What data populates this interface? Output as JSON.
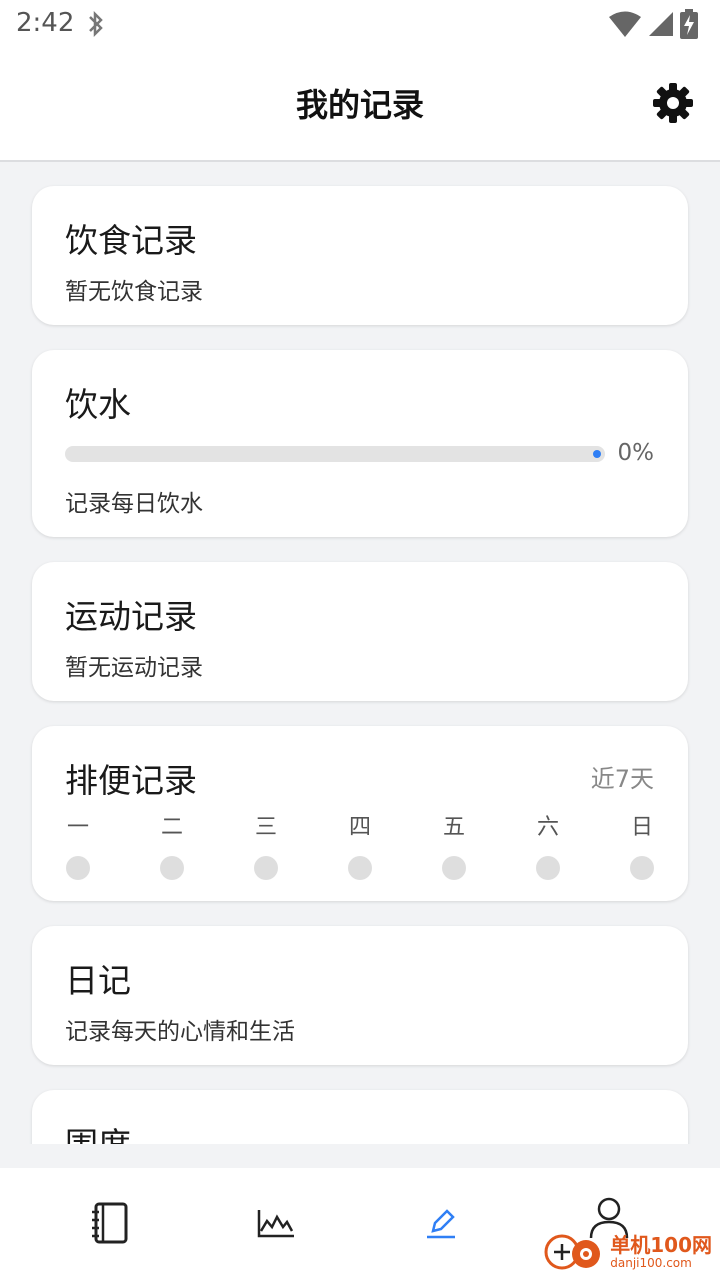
{
  "status_bar": {
    "time": "2:42"
  },
  "header": {
    "title": "我的记录"
  },
  "cards": {
    "diet": {
      "title": "饮食记录",
      "subtitle": "暂无饮食记录"
    },
    "water": {
      "title": "饮水",
      "progress_percent": 0,
      "progress_label": "0%",
      "subtitle": "记录每日饮水"
    },
    "exercise": {
      "title": "运动记录",
      "subtitle": "暂无运动记录"
    },
    "bowel": {
      "title": "排便记录",
      "range_label": "近7天",
      "days": [
        "一",
        "二",
        "三",
        "四",
        "五",
        "六",
        "日"
      ]
    },
    "diary": {
      "title": "日记",
      "subtitle": "记录每天的心情和生活"
    },
    "measurements": {
      "title": "围度"
    }
  },
  "bottom_nav": {
    "items": [
      {
        "icon": "notebook-icon",
        "active": false
      },
      {
        "icon": "line-chart-icon",
        "active": false
      },
      {
        "icon": "pencil-icon",
        "active": true
      },
      {
        "icon": "person-icon",
        "active": false
      }
    ]
  },
  "watermark": {
    "main": "单机100网",
    "sub": "danji100.com"
  },
  "colors": {
    "accent": "#2f7ff5",
    "background": "#f2f3f5",
    "card": "#ffffff",
    "watermark": "#e0581c"
  }
}
